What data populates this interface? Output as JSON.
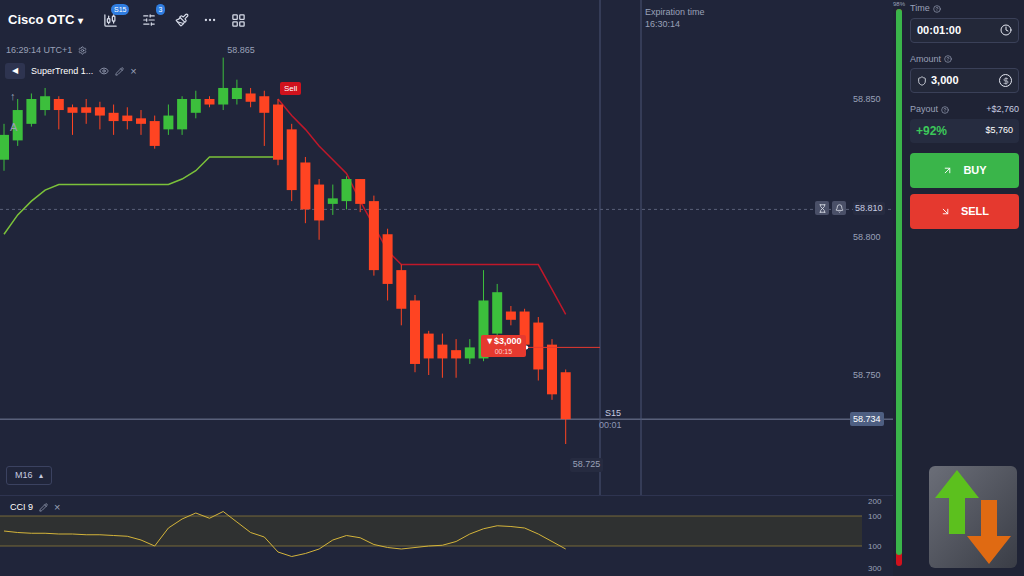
{
  "toolbar": {
    "asset": "Cisco OTC",
    "caret": "▾",
    "badges": [
      {
        "label": "S15"
      },
      {
        "label": "3"
      }
    ]
  },
  "clock": "16:29:14 UTC+1",
  "indicator_chip": {
    "collapse": "◀",
    "name": "SuperTrend 1...",
    "close": "×"
  },
  "left_tools": [
    "↑",
    "A"
  ],
  "chart": {
    "price_ticks": [
      "58.850",
      "58.800",
      "58.750"
    ],
    "high_label": "58.865",
    "low_label": "58.725",
    "candles": [
      [
        58.828,
        58.841,
        58.824,
        58.837
      ],
      [
        58.835,
        58.85,
        58.833,
        58.846
      ],
      [
        58.841,
        58.852,
        58.84,
        58.85
      ],
      [
        58.846,
        58.854,
        58.844,
        58.851
      ],
      [
        58.85,
        58.851,
        58.839,
        58.846
      ],
      [
        58.847,
        58.848,
        58.837,
        58.845
      ],
      [
        58.847,
        58.85,
        58.841,
        58.845
      ],
      [
        58.847,
        58.849,
        58.839,
        58.844
      ],
      [
        58.845,
        58.848,
        58.837,
        58.842
      ],
      [
        58.844,
        58.847,
        58.839,
        58.842
      ],
      [
        58.843,
        58.846,
        58.837,
        58.841
      ],
      [
        58.842,
        58.844,
        58.832,
        58.833
      ],
      [
        58.839,
        58.848,
        58.837,
        58.844
      ],
      [
        58.839,
        58.851,
        58.837,
        58.85
      ],
      [
        58.845,
        58.853,
        58.843,
        58.85
      ],
      [
        58.85,
        58.851,
        58.847,
        58.848
      ],
      [
        58.848,
        58.865,
        58.846,
        58.854
      ],
      [
        58.85,
        58.857,
        58.848,
        58.854
      ],
      [
        58.852,
        58.854,
        58.847,
        58.849
      ],
      [
        58.851,
        58.853,
        58.833,
        58.845
      ],
      [
        58.848,
        58.85,
        58.826,
        58.828
      ],
      [
        58.839,
        58.841,
        58.813,
        58.817
      ],
      [
        58.827,
        58.829,
        58.805,
        58.81
      ],
      [
        58.819,
        58.821,
        58.799,
        58.806
      ],
      [
        58.812,
        58.819,
        58.808,
        58.814
      ],
      [
        58.813,
        58.822,
        58.81,
        58.821
      ],
      [
        58.821,
        58.821,
        58.809,
        58.812
      ],
      [
        58.813,
        58.815,
        58.786,
        58.788
      ],
      [
        58.801,
        58.803,
        58.777,
        58.783
      ],
      [
        58.788,
        58.79,
        58.768,
        58.774
      ],
      [
        58.777,
        58.779,
        58.751,
        58.754
      ],
      [
        58.765,
        58.766,
        58.75,
        58.756
      ],
      [
        58.761,
        58.765,
        58.749,
        58.756
      ],
      [
        58.759,
        58.763,
        58.749,
        58.756
      ],
      [
        58.756,
        58.763,
        58.754,
        58.76
      ],
      [
        58.756,
        58.788,
        58.755,
        58.777
      ],
      [
        58.765,
        58.783,
        58.763,
        58.78
      ],
      [
        58.773,
        58.775,
        58.768,
        58.77
      ],
      [
        58.773,
        58.774,
        58.759,
        58.761
      ],
      [
        58.769,
        58.771,
        58.748,
        58.752
      ],
      [
        58.761,
        58.763,
        58.741,
        58.743
      ],
      [
        58.751,
        58.752,
        58.725,
        58.734
      ]
    ],
    "supertrend_up": [
      58.801,
      58.808,
      58.813,
      58.817,
      58.819,
      58.819,
      58.819,
      58.819,
      58.819,
      58.819,
      58.819,
      58.819,
      58.819,
      58.821,
      58.824,
      58.829,
      58.829,
      58.829,
      58.829,
      58.829,
      58.829,
      null,
      null,
      null,
      null,
      null,
      null,
      null,
      null,
      null,
      null,
      null,
      null,
      null,
      null,
      null,
      null,
      null,
      null,
      null,
      null,
      null
    ],
    "supertrend_down": [
      null,
      null,
      null,
      null,
      null,
      null,
      null,
      null,
      null,
      null,
      null,
      null,
      null,
      null,
      null,
      null,
      null,
      null,
      null,
      null,
      58.85,
      58.844,
      58.839,
      58.833,
      58.828,
      58.823,
      58.813,
      58.804,
      58.795,
      58.79,
      58.79,
      58.79,
      58.79,
      58.79,
      58.79,
      58.79,
      58.79,
      58.79,
      58.79,
      58.79,
      58.781,
      58.772
    ],
    "signal": {
      "label": "Sell"
    },
    "trade": {
      "label": "▼$3,000",
      "timer": "00:15",
      "price": 58.76,
      "candle": 36
    },
    "alert_line": {
      "price": "58.810"
    },
    "current_price": "58.734",
    "expiration": {
      "title": "Expiration time",
      "time": "16:30:14"
    },
    "candle_timer": {
      "period": "S15",
      "remaining": "00:01"
    },
    "timeframe": {
      "label": "M16",
      "caret": "▴"
    }
  },
  "cci": {
    "label": "CCI 9",
    "close": "×",
    "ticks": [
      "200",
      "100",
      "100",
      "300"
    ],
    "values": [
      0,
      -10,
      -15,
      -15,
      -20,
      -20,
      -25,
      -25,
      -30,
      -35,
      -60,
      -100,
      20,
      80,
      120,
      85,
      130,
      60,
      -10,
      -40,
      -140,
      -170,
      -150,
      -120,
      -60,
      -30,
      -45,
      -90,
      -110,
      -120,
      -110,
      -100,
      -95,
      -70,
      -20,
      15,
      35,
      30,
      20,
      -20,
      -70,
      -120
    ]
  },
  "progress": {
    "label": "98%",
    "level": 0.98
  },
  "panel": {
    "time": {
      "label": "Time",
      "value": "00:01:00"
    },
    "amount": {
      "label": "Amount",
      "value": "3,000"
    },
    "payout": {
      "label": "Payout",
      "profit": "+$2,760",
      "percent": "+92%",
      "total": "$5,760"
    },
    "buttons": [
      {
        "label": "BUY",
        "kind": "buy",
        "color": "#3ab54a"
      },
      {
        "label": "SELL",
        "kind": "sell",
        "color": "#e5392f"
      }
    ]
  }
}
